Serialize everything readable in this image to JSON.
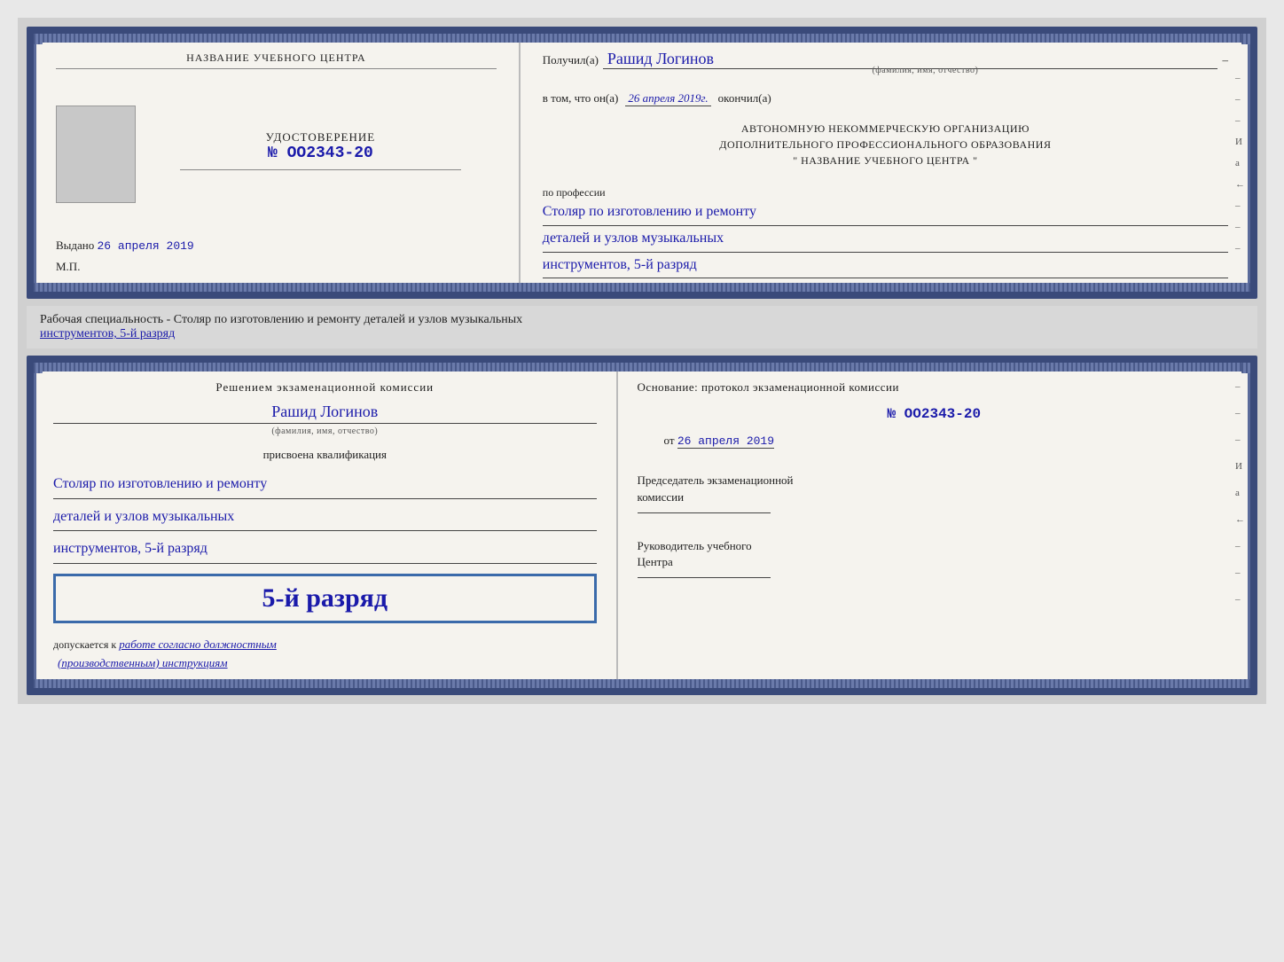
{
  "page": {
    "background": "#d0d0d0"
  },
  "top_diploma": {
    "left": {
      "center_name": "НАЗВАНИЕ УЧЕБНОГО ЦЕНТРА",
      "cert_label": "УДОСТОВЕРЕНИЕ",
      "cert_number": "№ OO2343-20",
      "issued_prefix": "Выдано",
      "issued_date": "26 апреля 2019",
      "mp_label": "М.П."
    },
    "right": {
      "recipient_prefix": "Получил(а)",
      "recipient_name": "Рашид Логинов",
      "fio_hint": "(фамилия, имя, отчество)",
      "date_prefix": "в том, что он(а)",
      "date_value": "26 апреля 2019г.",
      "date_suffix": "окончил(а)",
      "org_line1": "АВТОНОМНУЮ НЕКОММЕРЧЕСКУЮ ОРГАНИЗАЦИЮ",
      "org_line2": "ДОПОЛНИТЕЛЬНОГО ПРОФЕССИОНАЛЬНОГО ОБРАЗОВАНИЯ",
      "org_line3": "\"  НАЗВАНИЕ УЧЕБНОГО ЦЕНТРА  \"",
      "profession_label": "по профессии",
      "profession_line1": "Столяр по изготовлению и ремонту",
      "profession_line2": "деталей и узлов музыкальных",
      "profession_line3": "инструментов, 5-й разряд"
    }
  },
  "middle_text": {
    "text": "Рабочая специальность - Столяр по изготовлению и ремонту деталей и узлов музыкальных",
    "text2": "инструментов, 5-й разряд"
  },
  "bottom_diploma": {
    "left": {
      "commission_title": "Решением экзаменационной комиссии",
      "name": "Рашид Логинов",
      "fio_hint": "(фамилия, имя, отчество)",
      "qualification_label": "присвоена квалификация",
      "qual_line1": "Столяр по изготовлению и ремонту",
      "qual_line2": "деталей и узлов музыкальных",
      "qual_line3": "инструментов, 5-й разряд",
      "big_rank": "5-й разряд",
      "admit_prefix": "допускается к",
      "admit_text": "работе согласно должностным",
      "admit_text2": "(производственным) инструкциям"
    },
    "right": {
      "osnovaniye": "Основание: протокол экзаменационной комиссии",
      "protocol_number": "№ OO2343-20",
      "from_prefix": "от",
      "from_date": "26 апреля 2019",
      "chairman_label1": "Председатель экзаменационной",
      "chairman_label2": "комиссии",
      "director_label1": "Руководитель учебного",
      "director_label2": "Центра"
    }
  },
  "side_marks": {
    "marks": [
      "–",
      "–",
      "–",
      "И",
      "а",
      "←",
      "–",
      "–",
      "–"
    ]
  }
}
